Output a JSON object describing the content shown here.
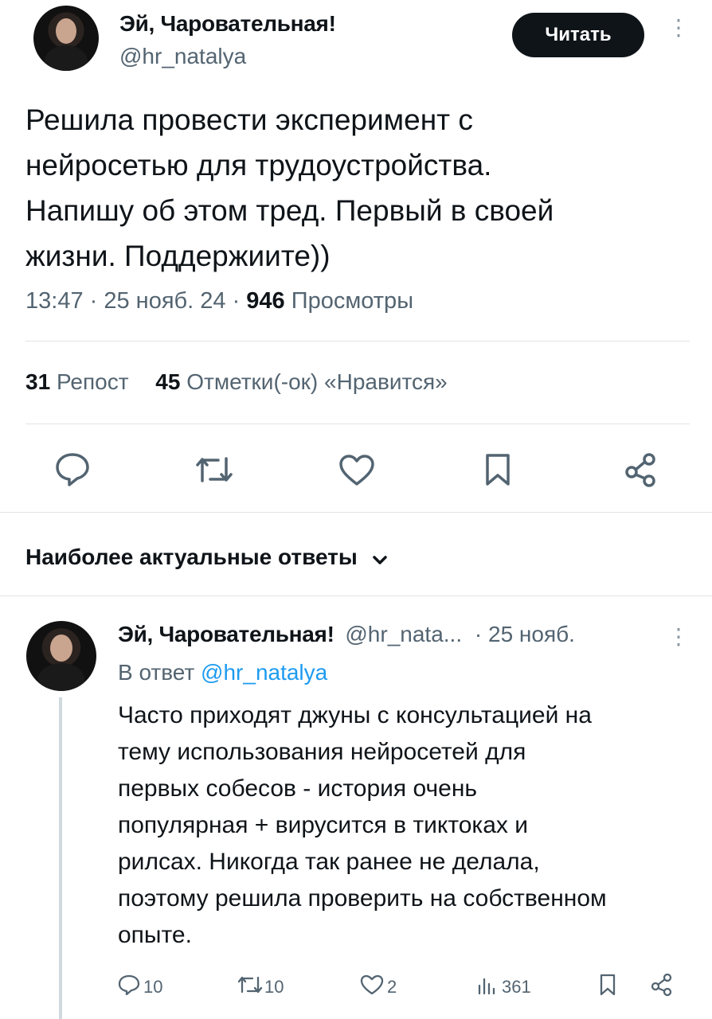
{
  "main_post": {
    "author_name": "Эй, Чаровательная!",
    "handle": "@hr_natalya",
    "follow_label": "Читать",
    "text_lines": [
      "Решила провести эксперимент с",
      "нейросетью для трудоустройства.",
      "Напишу об этом тред. Первый в своей",
      "жизни. Поддержиите))"
    ],
    "time": "13:47",
    "date": "25 нояб. 24",
    "views_count": "946",
    "views_label": "Просмотры",
    "reposts_count": "31",
    "reposts_label": "Репост",
    "likes_count": "45",
    "likes_label": "Отметки(-ок) «Нравится»",
    "actions": [
      "reply-icon",
      "repost-icon",
      "like-icon",
      "bookmark-icon",
      "share-icon"
    ]
  },
  "replies_section": {
    "title": "Наиболее актуальные ответы"
  },
  "reply": {
    "author_name": "Эй, Чаровательная!",
    "handle": "@hr_nata...",
    "date": "· 25 нояб.",
    "reply_to_prefix": "В ответ",
    "reply_to_handle": "@hr_natalya",
    "text_lines": [
      "Часто приходят джуны с консультацией на",
      "тему использования нейросетей для",
      "первых собесов - история очень",
      "популярная + вирусится в тиктоках и",
      "рилсах. Никогда так ранее не делала,",
      "поэтому решила проверить на собственном",
      "опыте."
    ],
    "replies_count": "10",
    "reposts_count": "10",
    "likes_count": "2",
    "views_count": "361"
  },
  "colors": {
    "text": "#0f1419",
    "muted": "#536471",
    "link": "#1d9bf0",
    "divider": "#dfe3e6",
    "button": "#0f1419"
  }
}
